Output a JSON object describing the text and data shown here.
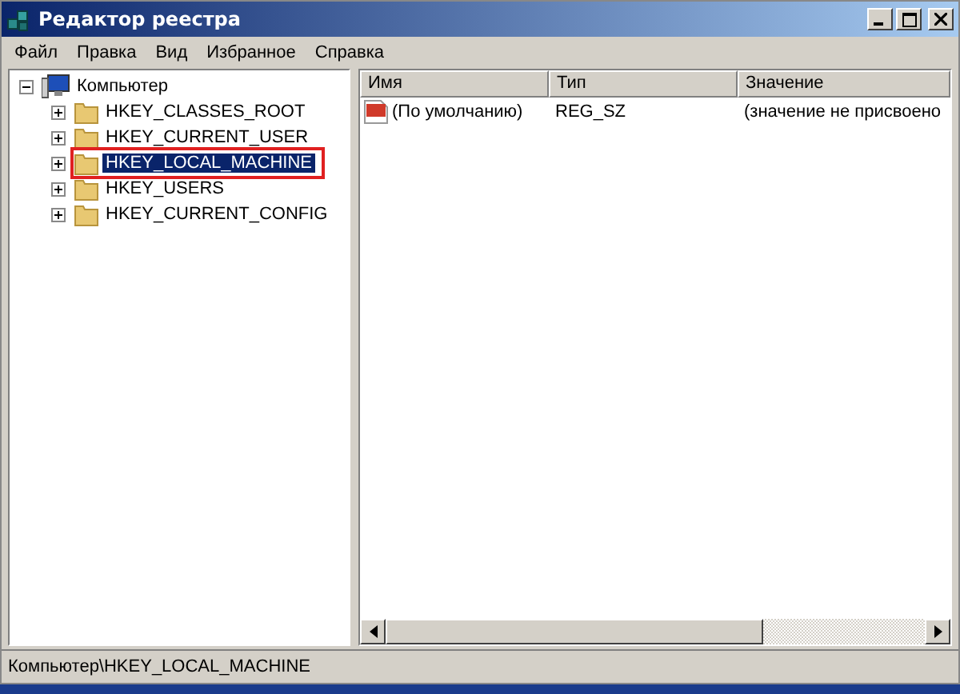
{
  "window": {
    "title": "Редактор реестра"
  },
  "menu": [
    "Файл",
    "Правка",
    "Вид",
    "Избранное",
    "Справка"
  ],
  "tree": {
    "label": "Компьютер",
    "expanded": true,
    "children": [
      {
        "label": "HKEY_CLASSES_ROOT",
        "expanded": false,
        "selected": false,
        "outlined": false
      },
      {
        "label": "HKEY_CURRENT_USER",
        "expanded": false,
        "selected": false,
        "outlined": false
      },
      {
        "label": "HKEY_LOCAL_MACHINE",
        "expanded": false,
        "selected": true,
        "outlined": true
      },
      {
        "label": "HKEY_USERS",
        "expanded": false,
        "selected": false,
        "outlined": false
      },
      {
        "label": "HKEY_CURRENT_CONFIG",
        "expanded": false,
        "selected": false,
        "outlined": false
      }
    ]
  },
  "table": {
    "columns": [
      "Имя",
      "Тип",
      "Значение"
    ],
    "rows": [
      {
        "name": "(По умолчанию)",
        "type": "REG_SZ",
        "value": "(значение не присвоено"
      }
    ]
  },
  "status_bar": "Компьютер\\HKEY_LOCAL_MACHINE"
}
